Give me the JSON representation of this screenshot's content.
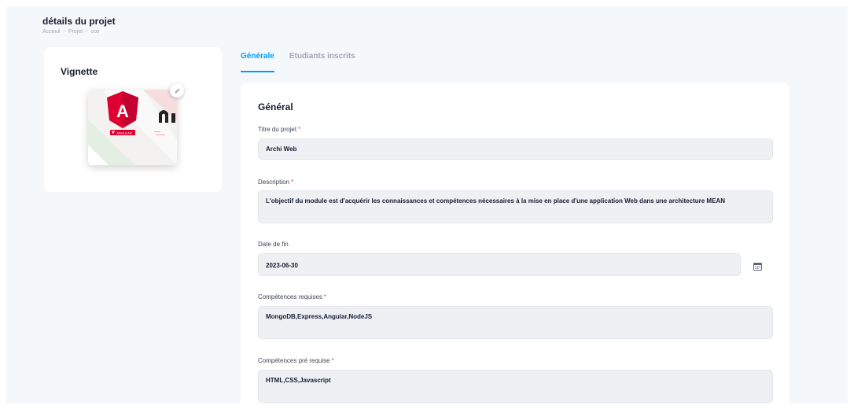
{
  "header": {
    "title": "détails du projet",
    "breadcrumb": [
      "Acceuil",
      "Projet",
      "voir"
    ],
    "breadcrumb_separator": "-"
  },
  "thumbnail": {
    "title": "Vignette",
    "image_badge": "ANGULAR",
    "edit_icon": "pencil-icon"
  },
  "tabs": [
    {
      "label": "Générale",
      "active": true
    },
    {
      "label": "Etudiants inscrits",
      "active": false
    }
  ],
  "form": {
    "title": "Général",
    "required_mark": "*",
    "fields": {
      "title": {
        "label": "Titre du projet",
        "value": "Archi Web",
        "required": true
      },
      "description": {
        "label": "Description",
        "value": "L'objectif du module est d'acquérir les connaissances et compétences nécessaires à la mise en place d'une application Web dans une architecture MEAN",
        "required": true
      },
      "end_date": {
        "label": "Date de fin",
        "value": "2023-06-30",
        "required": false,
        "icon": "calendar-icon"
      },
      "skills_required": {
        "label": "Compétences requises",
        "value": "MongoDB,Express,Angular,NodeJS",
        "required": true
      },
      "prerequisites": {
        "label": "Compétences pré requise",
        "value": "HTML,CSS,Javascript",
        "required": true
      }
    }
  },
  "colors": {
    "accent": "#009ef7",
    "required": "#f1416c",
    "page_bg": "#f5f8fa",
    "field_bg": "#eef0f4",
    "angular_red": "#dd0031"
  }
}
